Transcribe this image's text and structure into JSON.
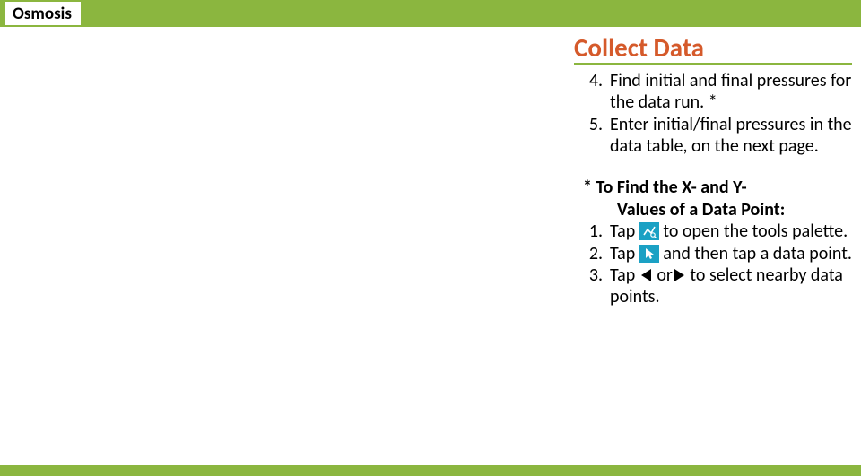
{
  "header": {
    "title": "Osmosis"
  },
  "section": {
    "title": "Collect Data"
  },
  "steps": [
    {
      "num": "4.",
      "text": "Find initial and final pressures for the data run. *"
    },
    {
      "num": "5.",
      "text": "Enter initial/final pressures in the data table, on the next page."
    }
  ],
  "note": {
    "title_line1": "* To Find the X- and Y-",
    "title_line2": "Values of a Data Point:",
    "items": [
      {
        "num": "1.",
        "pre": "Tap ",
        "icon": "graph-tools-icon",
        "post": " to open the tools palette."
      },
      {
        "num": "2.",
        "pre": "Tap ",
        "icon": "cursor-icon",
        "post": " and then tap a data point."
      },
      {
        "num": "3.",
        "pre": "Tap ",
        "mid": " or",
        "post": " to select nearby data points."
      }
    ]
  }
}
